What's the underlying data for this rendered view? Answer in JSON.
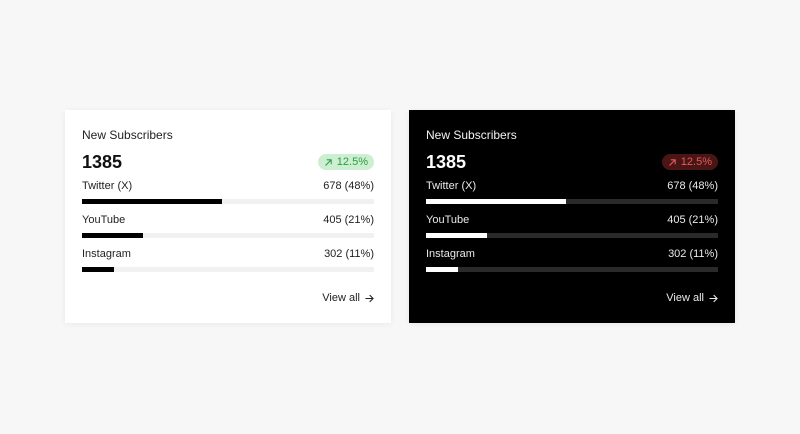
{
  "cards": [
    {
      "theme": "light",
      "title": "New Subscribers",
      "total": "1385",
      "badge": {
        "text": "12.5%",
        "direction": "up",
        "color": "#2e9a46",
        "background": "#cdefd1"
      },
      "rows": [
        {
          "label": "Twitter (X)",
          "value": "678 (48%)",
          "share": 0.48
        },
        {
          "label": "YouTube",
          "value": "405 (21%)",
          "share": 0.21
        },
        {
          "label": "Instagram",
          "value": "302 (11%)",
          "share": 0.11
        }
      ],
      "footer": {
        "label": "View all",
        "icon": "arrow-right-icon"
      }
    },
    {
      "theme": "dark",
      "title": "New Subscribers",
      "total": "1385",
      "badge": {
        "text": "12.5%",
        "direction": "up",
        "color": "#e25d5d",
        "background": "#4a1515"
      },
      "rows": [
        {
          "label": "Twitter (X)",
          "value": "678 (48%)",
          "share": 0.48
        },
        {
          "label": "YouTube",
          "value": "405 (21%)",
          "share": 0.21
        },
        {
          "label": "Instagram",
          "value": "302 (11%)",
          "share": 0.11
        }
      ],
      "footer": {
        "label": "View all",
        "icon": "arrow-right-icon"
      }
    }
  ]
}
